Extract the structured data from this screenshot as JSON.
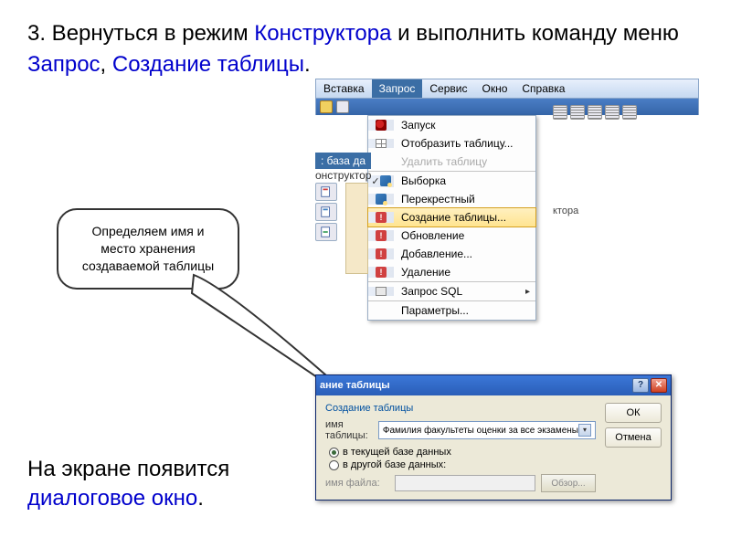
{
  "heading": {
    "prefix": "3. Вернуться в режим ",
    "konstruktor": "Конструктора",
    "mid": " и выполнить команду меню ",
    "zapros": "Запрос",
    "comma": ", ",
    "sozdanie": "Создание таблицы",
    "period": "."
  },
  "menubar": {
    "items": [
      "Вставка",
      "Запрос",
      "Сервис",
      "Окно",
      "Справка"
    ],
    "active_index": 1
  },
  "context": {
    "database_label": ": база да",
    "constructor_label": "онструктор"
  },
  "menu": [
    {
      "label": "Запуск",
      "icon": "run",
      "type": "item"
    },
    {
      "label": "Отобразить таблицу...",
      "icon": "table",
      "type": "item"
    },
    {
      "label": "Удалить таблицу",
      "icon": "",
      "type": "disabled"
    },
    {
      "label": "Выборка",
      "icon": "query",
      "type": "sep",
      "checked": true
    },
    {
      "label": "Перекрестный",
      "icon": "query",
      "type": "item"
    },
    {
      "label": "Создание таблицы...",
      "icon": "excl",
      "type": "highlighted"
    },
    {
      "label": "Обновление",
      "icon": "excl",
      "type": "item"
    },
    {
      "label": "Добавление...",
      "icon": "excl",
      "type": "item"
    },
    {
      "label": "Удаление",
      "icon": "excl",
      "type": "item"
    },
    {
      "label": "Запрос SQL",
      "icon": "sql",
      "type": "sep",
      "submenu": true
    },
    {
      "label": "Параметры...",
      "icon": "",
      "type": "sep"
    }
  ],
  "side_label": "ктора",
  "bubble": {
    "line1": "Определяем имя и",
    "line2": "место хранения",
    "line3": "создаваемой таблицы"
  },
  "bottom": {
    "line1": "На экране появится",
    "line2": "диалоговое окно",
    "period": "."
  },
  "dialog": {
    "title": "ание таблицы",
    "subtitle": "Создание таблицы",
    "field_label": "имя таблицы:",
    "field_value": "Фамилия факультеты оценки за все экзамены",
    "radio1": "в текущей базе данных",
    "radio2": "в другой базе данных:",
    "file_label": "имя файла:",
    "browse": "Обзор...",
    "ok": "ОК",
    "cancel": "Отмена",
    "close_x": "✕",
    "help_q": "?"
  }
}
